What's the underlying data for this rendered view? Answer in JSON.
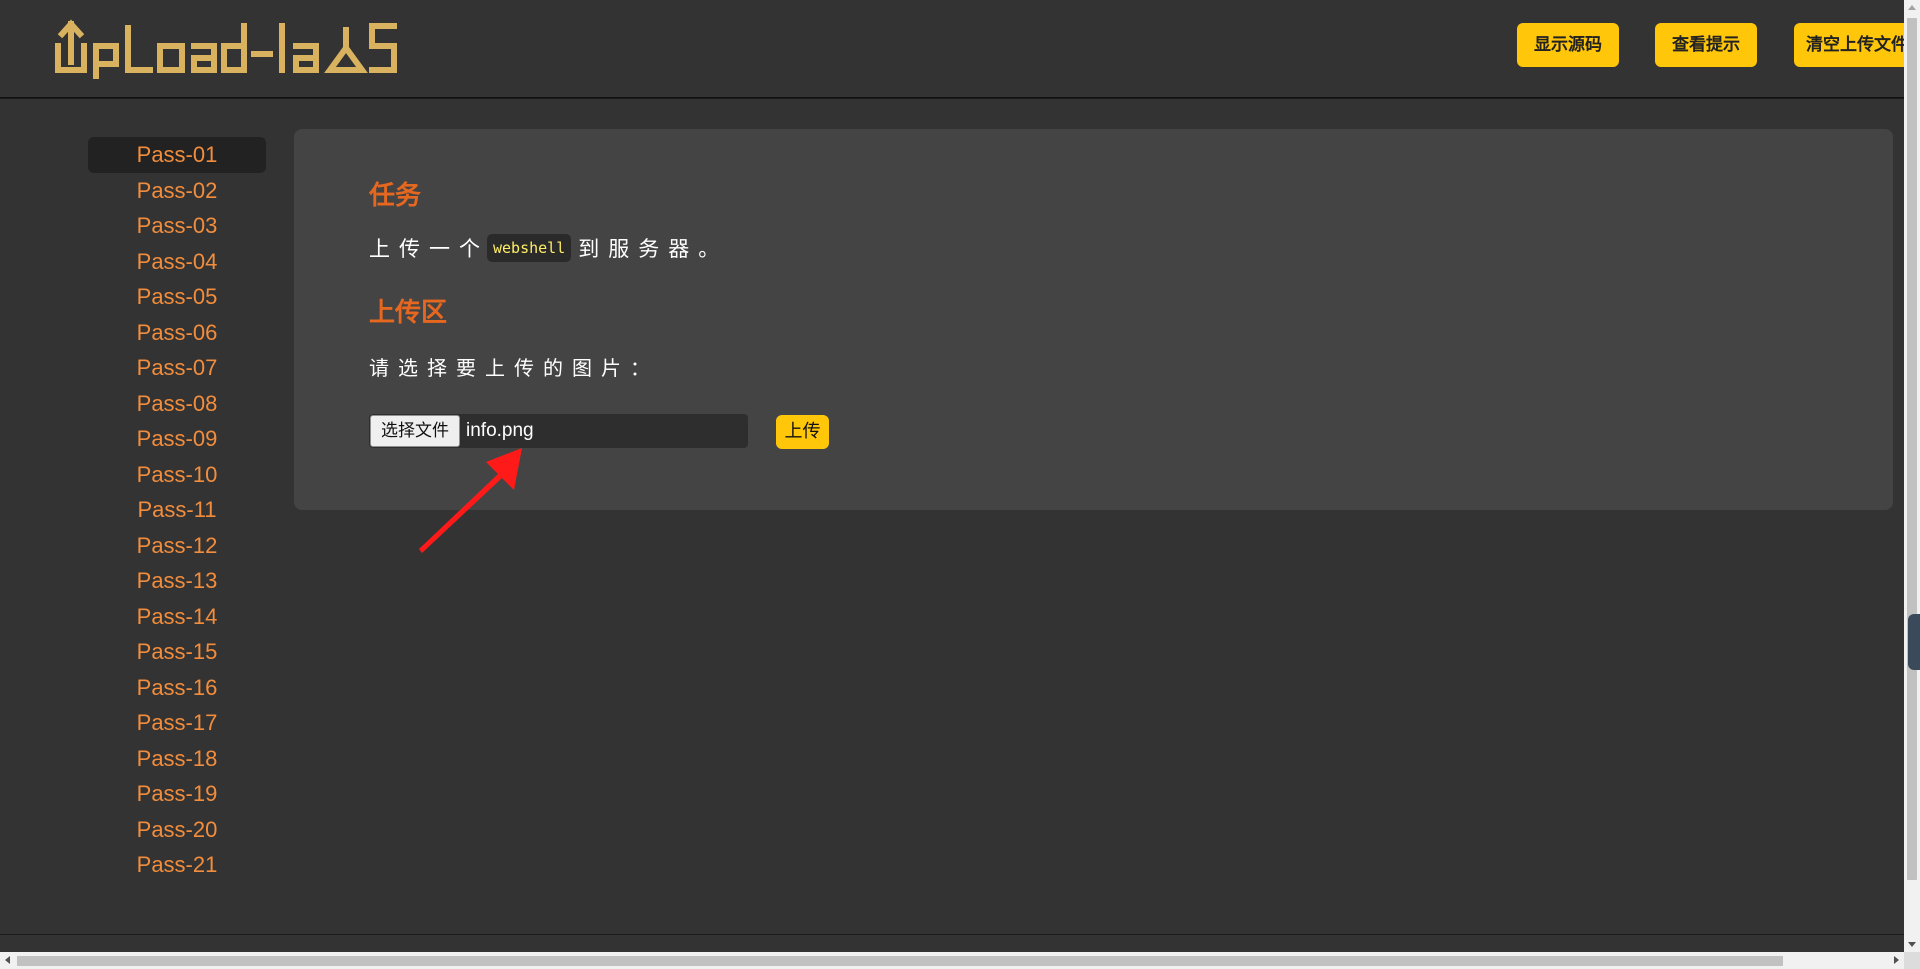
{
  "header": {
    "logo_text": "UpLoad-labs",
    "buttons": {
      "show_source": "显示源码",
      "view_hint": "查看提示",
      "clear_uploads": "清空上传文件"
    }
  },
  "sidebar": {
    "active": "Pass-01",
    "items": [
      "Pass-01",
      "Pass-02",
      "Pass-03",
      "Pass-04",
      "Pass-05",
      "Pass-06",
      "Pass-07",
      "Pass-08",
      "Pass-09",
      "Pass-10",
      "Pass-11",
      "Pass-12",
      "Pass-13",
      "Pass-14",
      "Pass-15",
      "Pass-16",
      "Pass-17",
      "Pass-18",
      "Pass-19",
      "Pass-20",
      "Pass-21"
    ]
  },
  "main": {
    "task_title": "任务",
    "task_prefix": "上传一个",
    "task_code": "webshell",
    "task_suffix": "到服务器。",
    "upload_title": "上传区",
    "prompt": "请选择要上传的图片：",
    "file_input": {
      "button_label": "选择文件",
      "selected_file": "info.png"
    },
    "submit_label": "上传"
  },
  "colors": {
    "background": "#333333",
    "panel": "#444444",
    "accent_button": "#ffc60a",
    "heading": "#e6671f",
    "sidebar_link": "#f28d3d",
    "logo": "#d9b25f",
    "annotation_arrow": "#ff1a1a"
  }
}
